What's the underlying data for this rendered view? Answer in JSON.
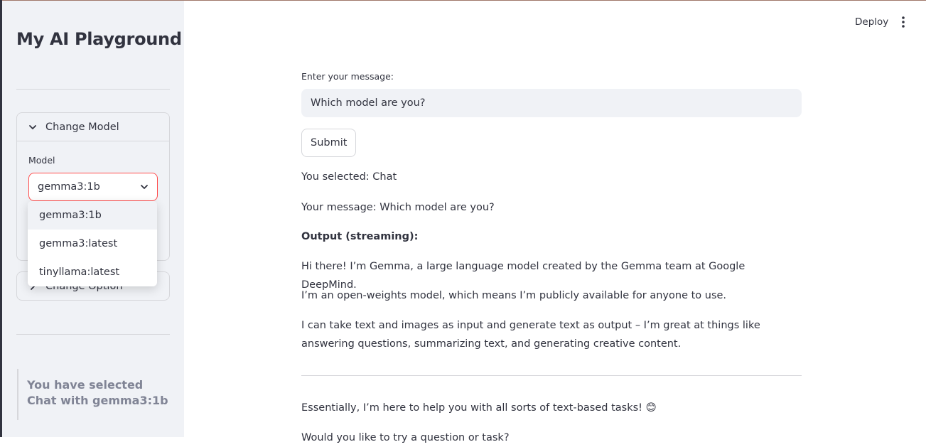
{
  "sidebar": {
    "title": "My AI Playground",
    "model_expander": {
      "label": "Change Model",
      "field_label": "Model",
      "selected": "gemma3:1b",
      "options": [
        "gemma3:1b",
        "gemma3:latest",
        "tinyllama:latest"
      ]
    },
    "option_expander": {
      "label": "Change Option"
    },
    "info": "You have selected Chat with gemma3:1b"
  },
  "toolbar": {
    "deploy_label": "Deploy"
  },
  "main": {
    "input_label": "Enter your message:",
    "input_value": "Which model are you?",
    "submit_label": "Submit",
    "selected_text": "You selected: Chat",
    "message_text": "Your message: Which model are you?",
    "output_heading": "Output (streaming):",
    "output_lines": [
      "Hi there! I’m Gemma, a large language model created by the Gemma team at Google DeepMind.",
      "I’m an open-weights model, which means I’m publicly available for anyone to use.",
      "I can take text and images as input and generate text as output – I’m great at things like answering questions, summarizing text, and generating creative content.",
      "Essentially, I’m here to help you with all sorts of text-based tasks! 😊",
      "Would you like to try a question or task?"
    ]
  },
  "colors": {
    "accent": "#ff4b4b",
    "sidebar_bg": "#f0f2f6",
    "text": "#31333f"
  }
}
